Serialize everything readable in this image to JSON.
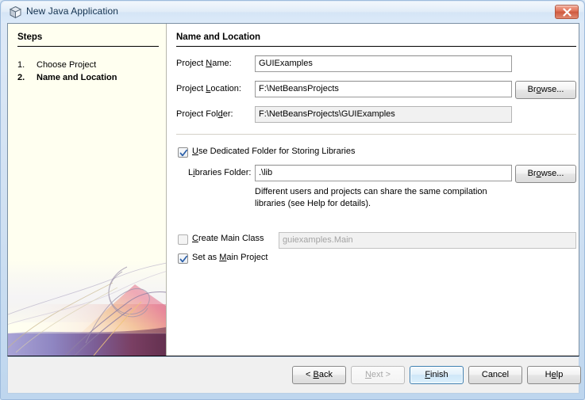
{
  "window": {
    "title": "New Java Application",
    "title_icon": "java-package-cube-icon",
    "close_label": "x",
    "border_color": "#9dbbdc"
  },
  "steps_panel": {
    "heading": "Steps",
    "items": [
      {
        "number": "1.",
        "label": "Choose Project",
        "current": false
      },
      {
        "number": "2.",
        "label": "Name and Location",
        "current": true
      }
    ],
    "background_color": "#fffff0",
    "artwork": "decorative-swirl-gradient"
  },
  "form": {
    "heading": "Name and Location",
    "project_name": {
      "label_pre": "Project ",
      "label_mn": "N",
      "label_post": "ame:",
      "value": "GUIExamples"
    },
    "project_location": {
      "label_pre": "Project ",
      "label_mn": "L",
      "label_post": "ocation:",
      "value": "F:\\NetBeansProjects",
      "browse_pre": "Br",
      "browse_mn": "o",
      "browse_post": "wse..."
    },
    "project_folder": {
      "label_pre": "Project Fol",
      "label_mn": "d",
      "label_post": "er:",
      "value": "F:\\NetBeansProjects\\GUIExamples"
    },
    "use_dedicated_folder": {
      "label_pre": "",
      "label_mn": "U",
      "label_post": "se Dedicated Folder for Storing Libraries",
      "checked": true
    },
    "libraries_folder": {
      "label_pre": "L",
      "label_mn": "i",
      "label_post": "braries Folder:",
      "value": ".\\lib",
      "browse_pre": "Br",
      "browse_mn": "o",
      "browse_post": "wse..."
    },
    "hint_line_1": "Different users and projects can share the same compilation",
    "hint_line_2": "libraries (see Help for details).",
    "create_main_class": {
      "label_pre": "",
      "label_mn": "C",
      "label_post": "reate Main Class",
      "checked": false,
      "value": "guiexamples.Main",
      "enabled": false
    },
    "set_as_main_project": {
      "label_pre": "Set as ",
      "label_mn": "M",
      "label_post": "ain Project",
      "checked": true
    }
  },
  "buttons": {
    "back": {
      "pre": "< ",
      "mn": "B",
      "post": "ack",
      "enabled": true
    },
    "next": {
      "pre": "",
      "mn": "N",
      "post": "ext >",
      "enabled": false
    },
    "finish": {
      "pre": "",
      "mn": "F",
      "post": "inish",
      "enabled": true,
      "is_default": true
    },
    "cancel": {
      "pre": "Cancel",
      "mn": "",
      "post": "",
      "enabled": true
    },
    "help": {
      "pre": "H",
      "mn": "e",
      "post": "lp",
      "enabled": true
    }
  }
}
